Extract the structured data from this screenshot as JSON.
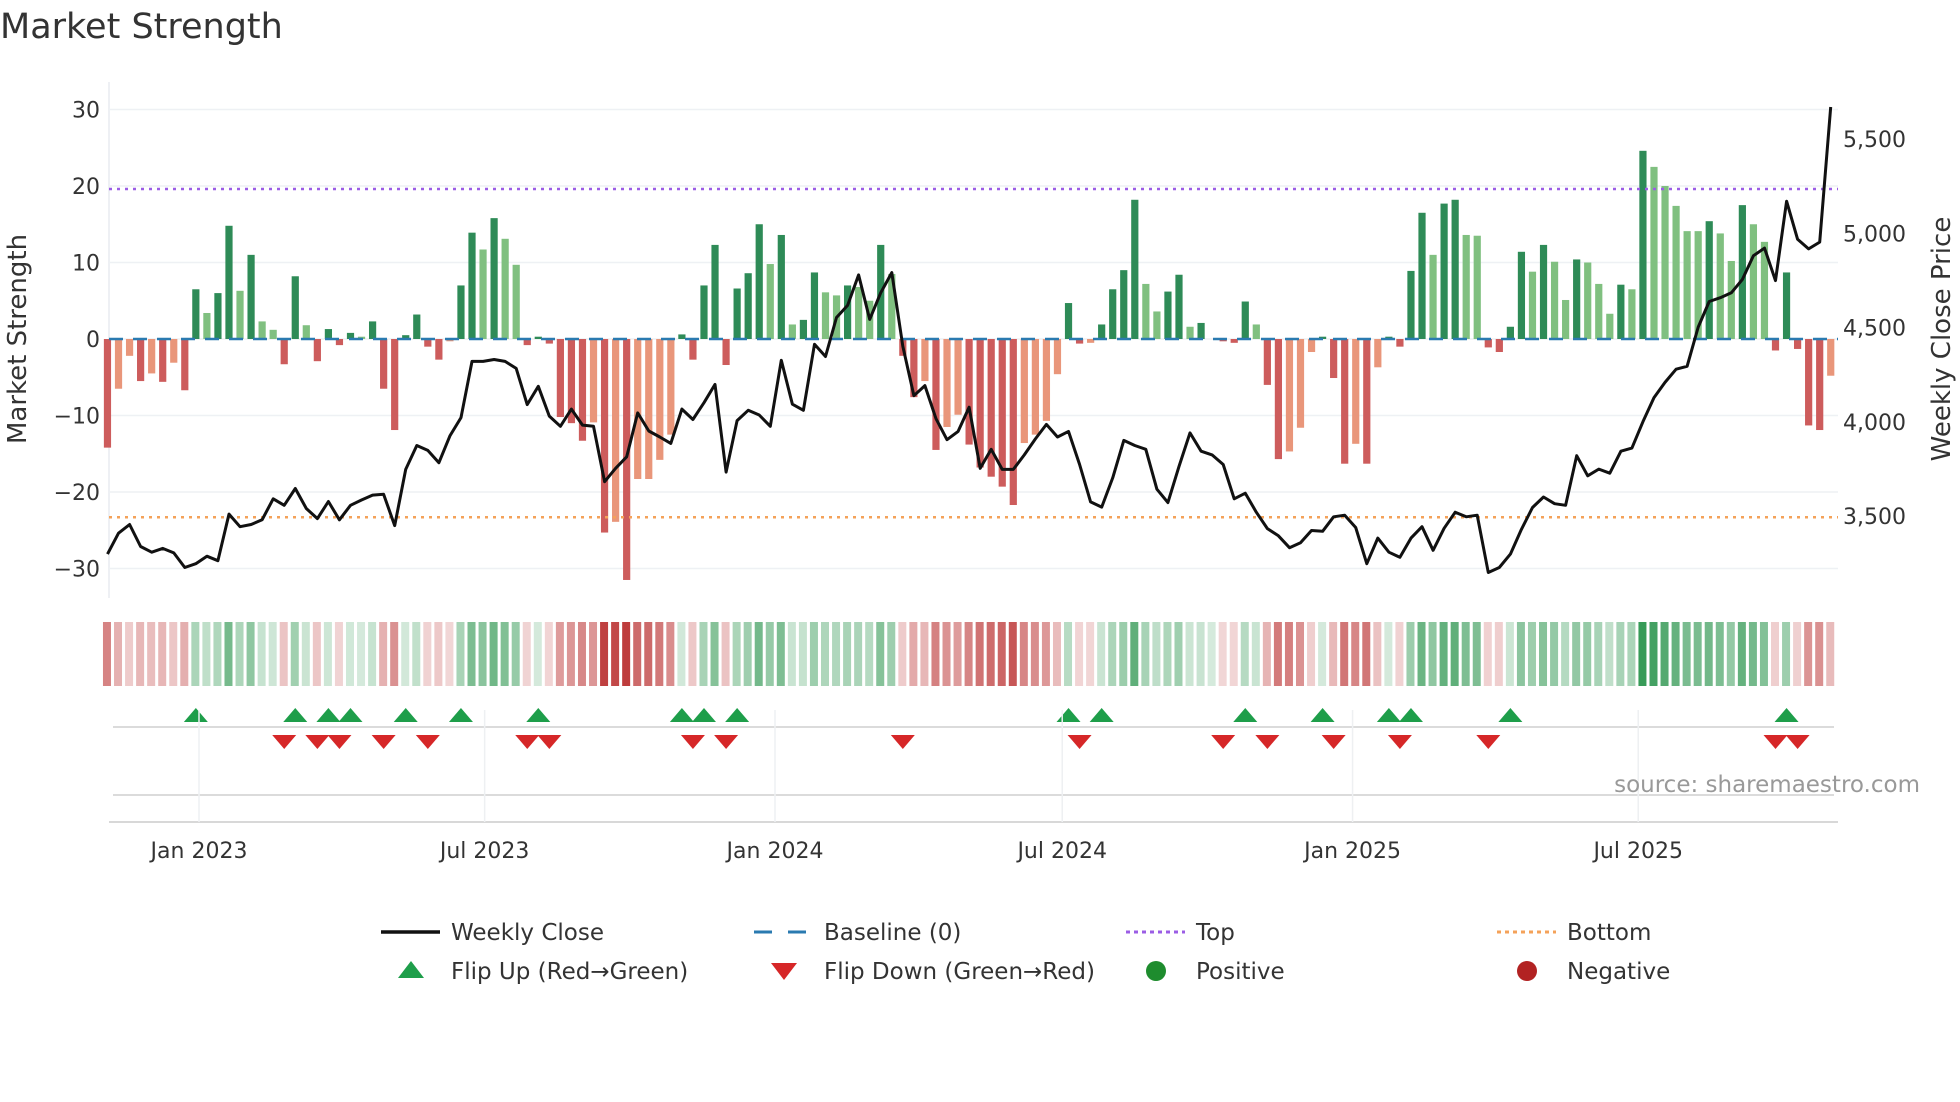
{
  "title": "Market Strength",
  "source": "source: sharemaestro.com",
  "chart_data": {
    "type": "bar",
    "title": "Market Strength",
    "ylabel": "Market Strength",
    "y2label": "Weekly Close Price",
    "ylim": [
      -34,
      33
    ],
    "y2lim": [
      3120,
      5720
    ],
    "yticks": [
      -30,
      -20,
      -10,
      0,
      10,
      20,
      30
    ],
    "y2ticks": [
      3500,
      4000,
      4500,
      5000,
      5500
    ],
    "y2ticklabels": [
      "3,500",
      "4,000",
      "4,500",
      "5,000",
      "5,500"
    ],
    "start_date": "2022-11-04",
    "frequency_days": 7,
    "xticks": [
      {
        "date": "2023-01-01",
        "label": "Jan 2023"
      },
      {
        "date": "2023-07-01",
        "label": "Jul 2023"
      },
      {
        "date": "2024-01-01",
        "label": "Jan 2024"
      },
      {
        "date": "2024-07-01",
        "label": "Jul 2024"
      },
      {
        "date": "2025-01-01",
        "label": "Jan 2025"
      },
      {
        "date": "2025-07-01",
        "label": "Jul 2025"
      }
    ],
    "top_line": 19.6,
    "bottom_line": -23.3,
    "baseline": 0,
    "strength": [
      -14.2,
      -6.5,
      -2.2,
      -5.5,
      -4.5,
      -5.6,
      -3.1,
      -6.7,
      6.5,
      3.4,
      6.0,
      14.8,
      6.3,
      11.0,
      2.3,
      1.2,
      -3.3,
      8.2,
      1.8,
      -2.9,
      1.3,
      -0.8,
      0.8,
      0.3,
      2.3,
      -6.5,
      -11.9,
      0.5,
      3.2,
      -1.0,
      -2.7,
      -0.3,
      7.0,
      13.9,
      11.7,
      15.8,
      13.1,
      9.7,
      -0.8,
      0.3,
      -0.6,
      -10.2,
      -11.0,
      -13.3,
      -10.9,
      -25.3,
      -23.9,
      -31.5,
      -18.3,
      -18.3,
      -15.8,
      -12.5,
      0.6,
      -2.7,
      7.0,
      12.3,
      -3.4,
      6.6,
      8.6,
      15.0,
      9.8,
      13.6,
      1.9,
      2.5,
      8.7,
      6.1,
      5.7,
      7.0,
      6.8,
      5.0,
      12.3,
      8.5,
      -2.2,
      -7.6,
      -5.5,
      -14.5,
      -11.5,
      -9.9,
      -13.8,
      -16.8,
      -18.0,
      -19.3,
      -21.7,
      -13.6,
      -12.5,
      -10.7,
      -4.6,
      4.7,
      -0.6,
      -0.5,
      1.9,
      6.5,
      9.0,
      18.2,
      7.2,
      3.6,
      6.2,
      8.4,
      1.6,
      2.1,
      0,
      -0.3,
      -0.5,
      4.9,
      1.9,
      -6.0,
      -15.7,
      -14.7,
      -11.6,
      -1.7,
      0.3,
      -5.1,
      -16.3,
      -13.7,
      -16.3,
      -3.7,
      0.3,
      -1.0,
      8.9,
      16.5,
      11.0,
      17.7,
      18.2,
      13.6,
      13.5,
      -1.1,
      -1.7,
      1.6,
      11.4,
      8.8,
      12.3,
      10.1,
      5.1,
      10.4,
      10.0,
      7.2,
      3.3,
      7.1,
      6.5,
      24.6,
      22.5,
      20.0,
      17.4,
      14.1,
      14.1,
      15.4,
      13.8,
      10.2,
      17.5,
      15.0,
      12.7,
      -1.5,
      8.7,
      -1.3,
      -11.3,
      -11.9,
      -4.8
    ],
    "weekly_close": [
      3298,
      3409,
      3455,
      3338,
      3308,
      3328,
      3304,
      3227,
      3247,
      3287,
      3263,
      3510,
      3443,
      3455,
      3480,
      3591,
      3557,
      3646,
      3540,
      3486,
      3577,
      3480,
      3557,
      3585,
      3611,
      3615,
      3449,
      3747,
      3874,
      3848,
      3783,
      3925,
      4022,
      4320,
      4320,
      4330,
      4320,
      4283,
      4091,
      4188,
      4030,
      3976,
      4067,
      3982,
      3976,
      3682,
      3753,
      3814,
      4047,
      3951,
      3919,
      3885,
      4067,
      4012,
      4101,
      4198,
      3733,
      4006,
      4061,
      4036,
      3976,
      4326,
      4093,
      4061,
      4411,
      4346,
      4553,
      4617,
      4779,
      4543,
      4684,
      4791,
      4401,
      4138,
      4192,
      4016,
      3905,
      3949,
      4077,
      3753,
      3854,
      3747,
      3747,
      3824,
      3909,
      3986,
      3919,
      3949,
      3773,
      3575,
      3547,
      3702,
      3901,
      3874,
      3854,
      3642,
      3571,
      3763,
      3941,
      3844,
      3824,
      3773,
      3591,
      3621,
      3520,
      3433,
      3395,
      3332,
      3358,
      3423,
      3419,
      3496,
      3504,
      3439,
      3247,
      3383,
      3308,
      3281,
      3383,
      3443,
      3318,
      3435,
      3520,
      3496,
      3504,
      3200,
      3227,
      3298,
      3429,
      3545,
      3601,
      3565,
      3557,
      3820,
      3713,
      3749,
      3727,
      3844,
      3860,
      4000,
      4128,
      4209,
      4279,
      4294,
      4502,
      4638,
      4658,
      4684,
      4755,
      4881,
      4921,
      4749,
      5170,
      4968,
      4917,
      4953,
      5670
    ],
    "flip_up_indices": [
      8,
      17,
      20,
      22,
      27,
      32,
      39,
      52,
      54,
      57,
      87,
      90,
      103,
      110,
      116,
      118,
      127,
      152
    ],
    "flip_down_indices": [
      16,
      19,
      21,
      25,
      29,
      38,
      40,
      53,
      56,
      72,
      88,
      101,
      105,
      111,
      117,
      125,
      151,
      153
    ],
    "legend": {
      "position": "bottom",
      "items": [
        {
          "label": "Weekly Close",
          "kind": "line"
        },
        {
          "label": "Baseline (0)",
          "kind": "dash"
        },
        {
          "label": "Top",
          "kind": "dot-purple"
        },
        {
          "label": "Bottom",
          "kind": "dot-orange"
        },
        {
          "label": "Flip Up (Red→Green)",
          "kind": "triangle-up"
        },
        {
          "label": "Flip Down (Green→Red)",
          "kind": "triangle-down"
        },
        {
          "label": "Positive",
          "kind": "circle-green"
        },
        {
          "label": "Negative",
          "kind": "circle-red"
        }
      ]
    }
  },
  "colors": {
    "pos_strong": "#2e8b57",
    "pos_weak": "#80c080",
    "neg_strong": "#cd5c5c",
    "neg_weak": "#e9967a",
    "baseline": "#2a7ab0",
    "top": "#9b5de5",
    "bottom": "#f4a259",
    "price": "#111111",
    "flip_up": "#1e9e4a",
    "flip_down": "#d62728",
    "positive": "#1e8c2e",
    "negative": "#b22222"
  }
}
